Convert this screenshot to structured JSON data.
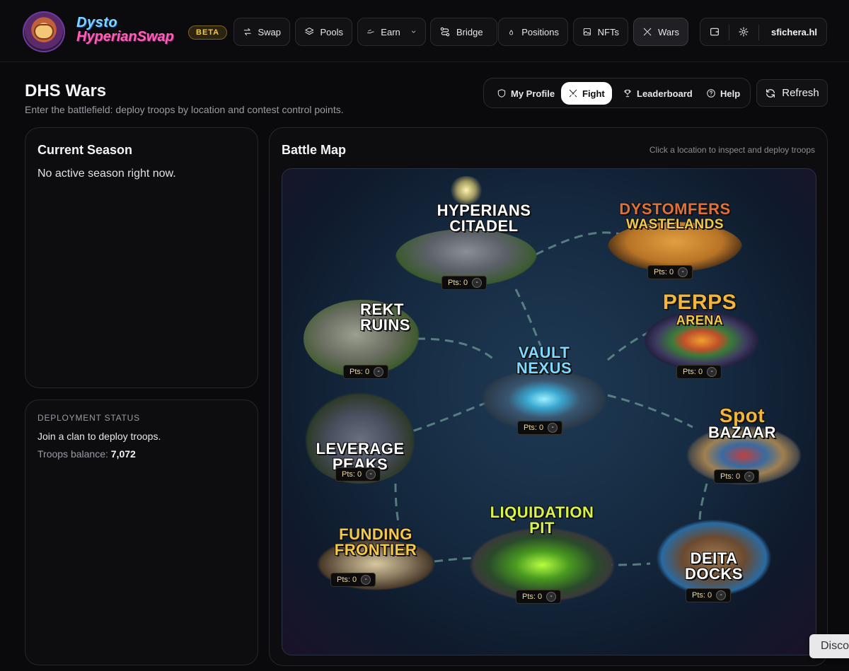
{
  "brand": {
    "line1": "Dysto",
    "line2": "HyperianSwap",
    "badge": "BETA"
  },
  "nav": [
    {
      "label": "Swap",
      "icon": "swap-arrows-icon"
    },
    {
      "label": "Pools",
      "icon": "layers-icon"
    },
    {
      "label": "Earn",
      "icon": "earn-icon"
    },
    {
      "label": "Bridge",
      "icon": "bridge-icon"
    },
    {
      "label": "Positions",
      "icon": "droplets-icon"
    },
    {
      "label": "NFTs",
      "icon": "images-icon"
    },
    {
      "label": "Wars",
      "icon": "crossed-swords-icon",
      "active": true
    }
  ],
  "account": {
    "username": "sfichera.hl"
  },
  "page": {
    "title": "DHS Wars",
    "subtitle": "Enter the battlefield: deploy troops by location and contest control points."
  },
  "tabs": [
    {
      "label": "My Profile",
      "icon": "shield-icon"
    },
    {
      "label": "Fight",
      "icon": "crossed-swords-icon",
      "active": true
    },
    {
      "label": "Leaderboard",
      "icon": "trophy-icon"
    },
    {
      "label": "Help",
      "icon": "help-circle-icon"
    }
  ],
  "refresh_label": "Refresh",
  "season": {
    "title": "Current Season",
    "message": "No active season right now."
  },
  "deployment": {
    "label": "DEPLOYMENT STATUS",
    "message": "Join a clan to deploy troops.",
    "balance_label": "Troops balance:",
    "balance_value": "7,072"
  },
  "battle_map": {
    "title": "Battle Map",
    "hint": "Click a location to inspect and deploy troops",
    "locations": [
      {
        "key": "citadel",
        "line1": "HYPERIANS",
        "line2": "CITADEL",
        "points": "Pts: 0",
        "color": "#ffffff"
      },
      {
        "key": "wastelands",
        "line1": "DYSTOMFERS",
        "line2": "WASTELANDS",
        "points": "Pts: 0",
        "color": "#e0703a"
      },
      {
        "key": "rekt",
        "line1": "REKT",
        "line2": "RUINS",
        "points": "Pts: 0",
        "color": "#ffffff"
      },
      {
        "key": "perps",
        "line1": "PERPS",
        "line2": "ARENA",
        "points": "Pts: 0",
        "color": "#f3b63a"
      },
      {
        "key": "vault",
        "line1": "VAULT",
        "line2": "NEXUS",
        "points": "Pts: 0",
        "color": "#7fd9ff"
      },
      {
        "key": "leverage",
        "line1": "LEVERAGE",
        "line2": "PEAKS",
        "points": "Pts: 0",
        "color": "#ffffff"
      },
      {
        "key": "spot",
        "line1": "Spot",
        "line2": "BAZAAR",
        "points": "Pts: 0",
        "color": "#f3b63a"
      },
      {
        "key": "liquidation",
        "line1": "LIQUIDATION",
        "line2": "PIT",
        "points": "Pts: 0",
        "color": "#d8f24a"
      },
      {
        "key": "funding",
        "line1": "FUNDING",
        "line2": "FRONTIER",
        "points": "Pts: 0",
        "color": "#f3c84b"
      },
      {
        "key": "delta",
        "line1": "DEITA",
        "line2": "DOCKS",
        "points": "Pts: 0",
        "color": "#ffffff"
      }
    ]
  },
  "float_button": "Disco"
}
